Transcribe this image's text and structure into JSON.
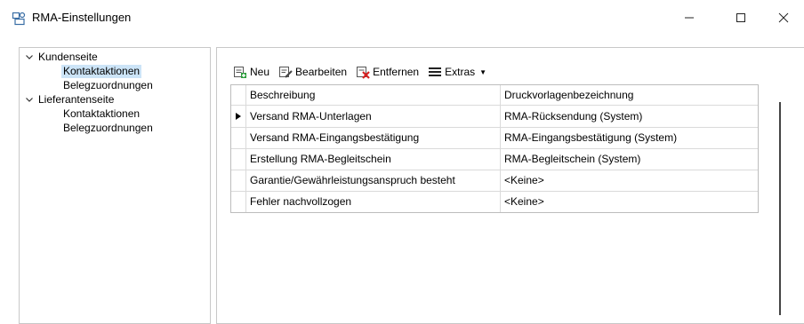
{
  "window": {
    "title": "RMA-Einstellungen",
    "icons": {
      "app": "rma-settings-icon",
      "minimize": "minimize-icon",
      "maximize": "maximize-icon",
      "close": "close-icon"
    }
  },
  "tree": {
    "items": [
      {
        "label": "Kundenseite",
        "level": 0,
        "expanded": true,
        "selected": false
      },
      {
        "label": "Kontaktaktionen",
        "level": 1,
        "selected": true
      },
      {
        "label": "Belegzuordnungen",
        "level": 1,
        "selected": false
      },
      {
        "label": "Lieferantenseite",
        "level": 0,
        "expanded": true,
        "selected": false
      },
      {
        "label": "Kontaktaktionen",
        "level": 1,
        "selected": false
      },
      {
        "label": "Belegzuordnungen",
        "level": 1,
        "selected": false
      }
    ]
  },
  "toolbar": {
    "new_label": "Neu",
    "edit_label": "Bearbeiten",
    "remove_label": "Entfernen",
    "extras_label": "Extras",
    "icons": {
      "new": "new-icon",
      "edit": "edit-icon",
      "remove": "remove-icon",
      "extras": "menu-icon"
    }
  },
  "table": {
    "columns": [
      "Beschreibung",
      "Druckvorlagenbezeichnung"
    ],
    "current_row_indicator": 0,
    "rows": [
      [
        "Versand RMA-Unterlagen",
        "RMA-Rücksendung (System)"
      ],
      [
        "Versand RMA-Eingangsbestätigung",
        "RMA-Eingangsbestätigung (System)"
      ],
      [
        "Erstellung RMA-Begleitschein",
        "RMA-Begleitschein (System)"
      ],
      [
        "Garantie/Gewährleistungsanspruch besteht",
        "<Keine>"
      ],
      [
        "Fehler nachvollzogen",
        "<Keine>"
      ]
    ]
  },
  "colors": {
    "selection": "#cce4f7",
    "border": "#c8c8c8",
    "grid_line": "#dadada"
  }
}
